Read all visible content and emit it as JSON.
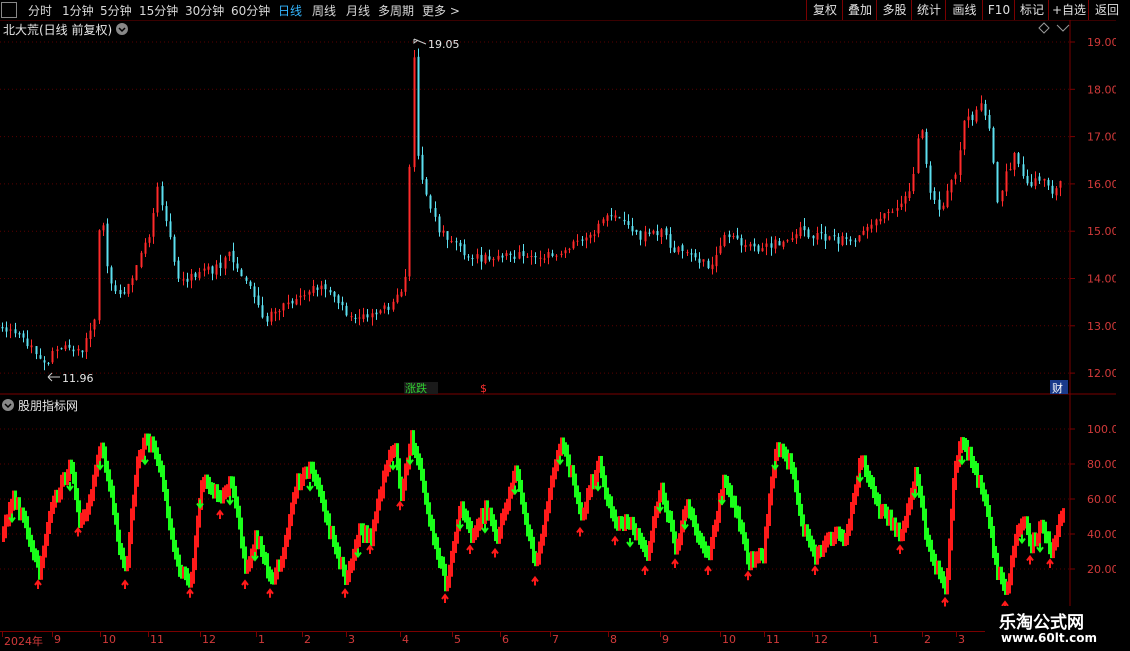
{
  "toolbar": {
    "timeframes": [
      "分时",
      "1分钟",
      "5分钟",
      "15分钟",
      "30分钟",
      "60分钟",
      "日线",
      "周线",
      "月线",
      "多周期",
      "更多 >"
    ],
    "active": "日线",
    "right_buttons": [
      "复权",
      "叠加",
      "多股",
      "统计",
      "画线",
      "F10",
      "标记",
      "+自选",
      "返回"
    ]
  },
  "main_chart": {
    "title": "北大荒(日线 前复权)",
    "y_ticks": [
      "19.00",
      "18.00",
      "17.00",
      "16.00",
      "15.00",
      "14.00",
      "13.00",
      "12.00"
    ],
    "high_label": "19.05",
    "low_label": "11.96",
    "markers": {
      "limit_down": "涨跌",
      "dollar": "$",
      "finance": "财"
    }
  },
  "indicator_chart": {
    "title": "股朋指标网",
    "y_ticks": [
      "100.0",
      "80.00",
      "60.00",
      "40.00",
      "20.00"
    ]
  },
  "date_axis": {
    "labels": [
      "2024年",
      "9",
      "10",
      "11",
      "12",
      "1",
      "2",
      "3",
      "4",
      "5",
      "6",
      "7",
      "8",
      "9",
      "10",
      "11",
      "12",
      "1",
      "2",
      "3"
    ]
  },
  "watermark": {
    "title": "乐淘公式网",
    "url": "www.60lt.com"
  },
  "colors": {
    "up": "#ff2a2a",
    "down": "#5ce0f0",
    "osc_up": "#ff1a1a",
    "osc_down": "#19ff19",
    "grid": "#5a0000",
    "axis": "#d23a3a",
    "accent": "#33b6ff"
  },
  "chart_data": {
    "type": "candlestick",
    "price_range": [
      11.96,
      19.05
    ],
    "price_points": [
      [
        0,
        12.95
      ],
      [
        20,
        12.8
      ],
      [
        45,
        12.2
      ],
      [
        60,
        12.6
      ],
      [
        80,
        12.4
      ],
      [
        95,
        13.2
      ],
      [
        100,
        15.7
      ],
      [
        108,
        14.0
      ],
      [
        120,
        13.6
      ],
      [
        135,
        14.2
      ],
      [
        150,
        15.0
      ],
      [
        157,
        15.9
      ],
      [
        165,
        15.3
      ],
      [
        180,
        13.9
      ],
      [
        195,
        14.1
      ],
      [
        215,
        14.2
      ],
      [
        230,
        14.5
      ],
      [
        250,
        13.8
      ],
      [
        265,
        13.1
      ],
      [
        280,
        13.4
      ],
      [
        300,
        13.6
      ],
      [
        315,
        13.8
      ],
      [
        330,
        13.7
      ],
      [
        345,
        13.3
      ],
      [
        360,
        13.2
      ],
      [
        380,
        13.3
      ],
      [
        395,
        13.5
      ],
      [
        405,
        13.9
      ],
      [
        407,
        14.4
      ],
      [
        410,
        16.8
      ],
      [
        414,
        18.9
      ],
      [
        418,
        16.4
      ],
      [
        425,
        15.8
      ],
      [
        440,
        15.0
      ],
      [
        460,
        14.6
      ],
      [
        480,
        14.4
      ],
      [
        500,
        14.5
      ],
      [
        520,
        14.5
      ],
      [
        540,
        14.4
      ],
      [
        560,
        14.6
      ],
      [
        580,
        14.8
      ],
      [
        600,
        15.1
      ],
      [
        607,
        15.4
      ],
      [
        620,
        15.2
      ],
      [
        640,
        14.9
      ],
      [
        660,
        15.0
      ],
      [
        675,
        14.6
      ],
      [
        690,
        14.6
      ],
      [
        710,
        14.2
      ],
      [
        725,
        14.9
      ],
      [
        740,
        14.8
      ],
      [
        760,
        14.6
      ],
      [
        780,
        14.8
      ],
      [
        800,
        15.0
      ],
      [
        820,
        14.9
      ],
      [
        840,
        14.8
      ],
      [
        860,
        14.9
      ],
      [
        880,
        15.3
      ],
      [
        900,
        15.6
      ],
      [
        912,
        16.0
      ],
      [
        920,
        17.5
      ],
      [
        928,
        16.0
      ],
      [
        940,
        15.4
      ],
      [
        955,
        16.2
      ],
      [
        965,
        17.4
      ],
      [
        975,
        17.4
      ],
      [
        982,
        17.8
      ],
      [
        990,
        17.0
      ],
      [
        997,
        15.6
      ],
      [
        1005,
        16.2
      ],
      [
        1015,
        16.6
      ],
      [
        1025,
        16.0
      ],
      [
        1040,
        16.1
      ],
      [
        1055,
        15.8
      ],
      [
        1062,
        16.2
      ]
    ],
    "oscillator_range": [
      0,
      100
    ],
    "oscillator_points": [
      [
        0,
        40
      ],
      [
        12,
        62
      ],
      [
        25,
        45
      ],
      [
        38,
        20
      ],
      [
        50,
        55
      ],
      [
        62,
        72
      ],
      [
        70,
        80
      ],
      [
        78,
        50
      ],
      [
        85,
        55
      ],
      [
        92,
        70
      ],
      [
        100,
        92
      ],
      [
        108,
        70
      ],
      [
        118,
        35
      ],
      [
        125,
        20
      ],
      [
        135,
        80
      ],
      [
        145,
        95
      ],
      [
        150,
        92
      ],
      [
        160,
        75
      ],
      [
        170,
        40
      ],
      [
        178,
        18
      ],
      [
        190,
        15
      ],
      [
        200,
        70
      ],
      [
        210,
        68
      ],
      [
        220,
        60
      ],
      [
        230,
        72
      ],
      [
        238,
        45
      ],
      [
        245,
        20
      ],
      [
        255,
        40
      ],
      [
        270,
        15
      ],
      [
        282,
        30
      ],
      [
        295,
        70
      ],
      [
        310,
        80
      ],
      [
        320,
        60
      ],
      [
        335,
        30
      ],
      [
        345,
        15
      ],
      [
        358,
        42
      ],
      [
        370,
        40
      ],
      [
        385,
        80
      ],
      [
        393,
        92
      ],
      [
        400,
        65
      ],
      [
        410,
        95
      ],
      [
        420,
        75
      ],
      [
        430,
        45
      ],
      [
        445,
        12
      ],
      [
        460,
        58
      ],
      [
        470,
        40
      ],
      [
        485,
        56
      ],
      [
        495,
        38
      ],
      [
        515,
        78
      ],
      [
        520,
        60
      ],
      [
        535,
        22
      ],
      [
        550,
        70
      ],
      [
        560,
        95
      ],
      [
        570,
        75
      ],
      [
        580,
        50
      ],
      [
        590,
        70
      ],
      [
        598,
        80
      ],
      [
        606,
        62
      ],
      [
        615,
        45
      ],
      [
        630,
        48
      ],
      [
        645,
        28
      ],
      [
        660,
        68
      ],
      [
        675,
        32
      ],
      [
        685,
        58
      ],
      [
        698,
        38
      ],
      [
        708,
        28
      ],
      [
        722,
        72
      ],
      [
        735,
        55
      ],
      [
        748,
        25
      ],
      [
        762,
        30
      ],
      [
        775,
        92
      ],
      [
        790,
        80
      ],
      [
        800,
        48
      ],
      [
        815,
        28
      ],
      [
        828,
        40
      ],
      [
        845,
        40
      ],
      [
        860,
        85
      ],
      [
        870,
        70
      ],
      [
        878,
        55
      ],
      [
        890,
        48
      ],
      [
        900,
        40
      ],
      [
        915,
        76
      ],
      [
        925,
        40
      ],
      [
        935,
        22
      ],
      [
        945,
        10
      ],
      [
        953,
        80
      ],
      [
        962,
        95
      ],
      [
        972,
        80
      ],
      [
        985,
        58
      ],
      [
        995,
        22
      ],
      [
        1005,
        8
      ],
      [
        1015,
        40
      ],
      [
        1022,
        50
      ],
      [
        1030,
        34
      ],
      [
        1040,
        45
      ],
      [
        1050,
        32
      ],
      [
        1062,
        54
      ]
    ]
  }
}
